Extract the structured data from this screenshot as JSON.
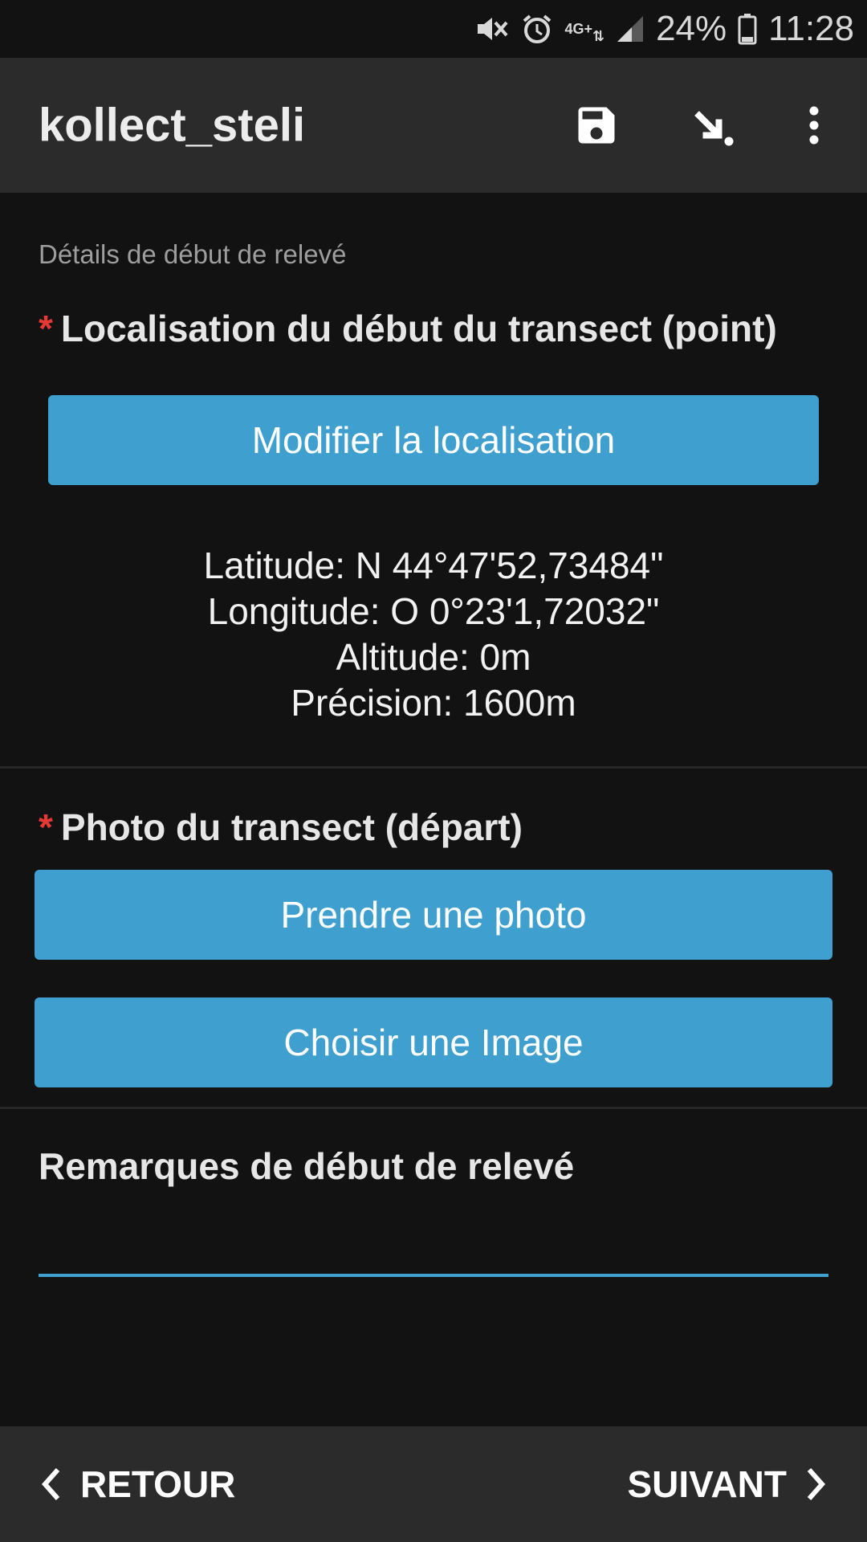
{
  "status_bar": {
    "network": "4G+",
    "battery": "24%",
    "time": "11:28",
    "icons": [
      "mute-icon",
      "alarm-icon",
      "signal-icon",
      "battery-icon"
    ]
  },
  "app_bar": {
    "title": "kollect_steli",
    "actions": [
      "save-icon",
      "goto-icon",
      "more-icon"
    ]
  },
  "form": {
    "section_label": "Détails de début de relevé",
    "location": {
      "required_mark": "*",
      "title": "Localisation du début du transect (point)",
      "button_label": "Modifier la localisation",
      "latitude": "Latitude: N 44°47'52,73484\"",
      "longitude": "Longitude: O 0°23'1,72032\"",
      "altitude": "Altitude: 0m",
      "precision": "Précision: 1600m"
    },
    "photo": {
      "required_mark": "*",
      "title": "Photo du transect (départ)",
      "take_photo_label": "Prendre une photo",
      "choose_image_label": "Choisir une Image"
    },
    "remarks": {
      "title": "Remarques de début de relevé",
      "value": ""
    }
  },
  "navigation": {
    "back_label": "RETOUR",
    "next_label": "SUIVANT"
  },
  "colors": {
    "accent": "#3f9fce",
    "required": "#e53935",
    "background": "#121212",
    "bar": "#2b2b2b"
  }
}
